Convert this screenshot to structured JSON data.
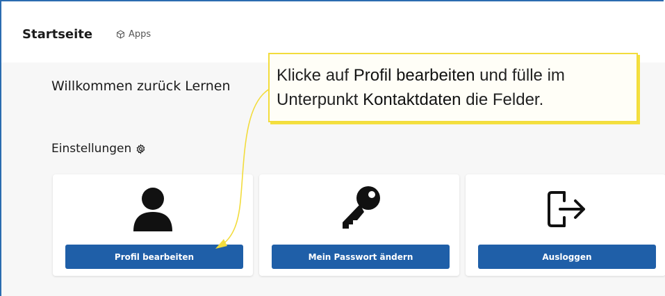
{
  "header": {
    "title": "Startseite",
    "apps_label": "Apps"
  },
  "welcome": "Willkommen zurück Lernen",
  "settings": {
    "heading": "Einstellungen"
  },
  "cards": [
    {
      "label": "Profil bearbeiten",
      "icon": "user-icon"
    },
    {
      "label": "Mein Passwort ändern",
      "icon": "key-icon"
    },
    {
      "label": "Ausloggen",
      "icon": "logout-icon"
    }
  ],
  "callout": {
    "t1": "Klicke auf ",
    "t2": "Profil bearbeiten",
    "t3": " und fülle im",
    "t4": "Unterpunkt ",
    "t5": "Kontaktdaten",
    "t6": " die Felder."
  },
  "colors": {
    "accent": "#1f5fa8",
    "callout_border": "#f2dc3c"
  }
}
